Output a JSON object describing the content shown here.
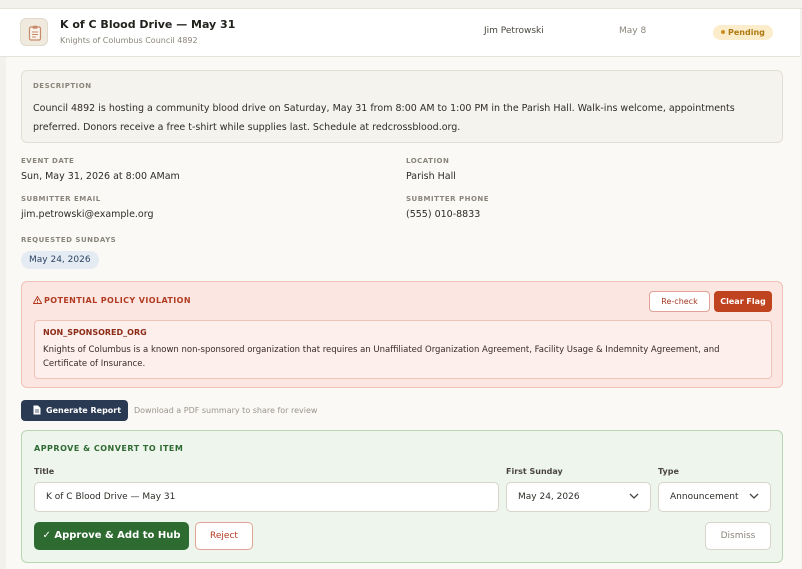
{
  "row": {
    "title": "K of C Blood Drive — May 31",
    "organization": "Knights of Columbus Council 4892",
    "submitter": "Jim Petrowski",
    "date": "May 8",
    "status": "Pending",
    "icon": "clipboard-icon",
    "status_color": "#fbeccb"
  },
  "description": {
    "label": "DESCRIPTION",
    "text": "Council 4892 is hosting a community blood drive on Saturday, May 31 from 8:00 AM to 1:00 PM in the Parish Hall. Walk-ins welcome, appointments preferred. Donors receive a free t-shirt while supplies last. Schedule at redcrossblood.org."
  },
  "details": {
    "event_date_label": "EVENT DATE",
    "event_date": "Sun, May 31, 2026 at 8:00 AMam",
    "location_label": "LOCATION",
    "location": "Parish Hall",
    "email_label": "SUBMITTER EMAIL",
    "email": "jim.petrowski@example.org",
    "phone_label": "SUBMITTER PHONE",
    "phone": "(555) 010-8833",
    "sundays_label": "REQUESTED SUNDAYS",
    "sundays": [
      "May 24, 2026"
    ]
  },
  "flag": {
    "title": "POTENTIAL POLICY VIOLATION",
    "icon": "warning-icon",
    "recheck_label": "Re-check",
    "clear_label": "Clear Flag",
    "code": "NON_SPONSORED_ORG",
    "message": "Knights of Columbus is a known non-sponsored organization that requires an Unaffiliated Organization Agreement, Facility Usage & Indemnity Agreement, and Certificate of Insurance.",
    "accent_color": "#c0431f"
  },
  "report": {
    "button_label": "Generate Report",
    "hint": "Download a PDF summary to share for review",
    "icon": "document-icon"
  },
  "approve": {
    "title": "APPROVE & CONVERT TO ITEM",
    "title_label": "Title",
    "title_value": "K of C Blood Drive — May 31",
    "first_sunday_label": "First Sunday",
    "first_sunday_value": "May 24, 2026",
    "type_label": "Type",
    "type_value": "Announcement",
    "approve_label": "✓ Approve & Add to Hub",
    "reject_label": "Reject",
    "dismiss_label": "Dismiss",
    "accent_color": "#2e6b31"
  }
}
